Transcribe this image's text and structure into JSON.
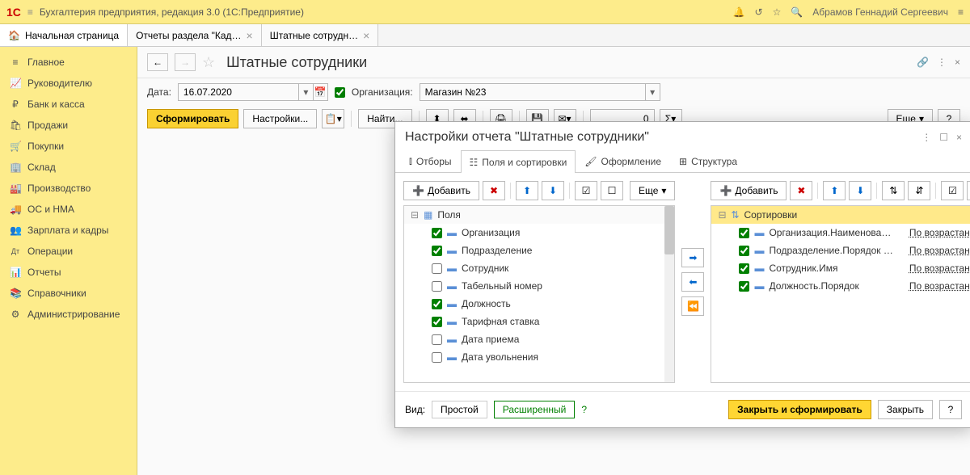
{
  "titlebar": {
    "title": "Бухгалтерия предприятия, редакция 3.0  (1С:Предприятие)",
    "user": "Абрамов Геннадий Сергеевич"
  },
  "tabs": {
    "home": "Начальная страница",
    "t1": "Отчеты раздела \"Кад…",
    "t2": "Штатные сотрудн…"
  },
  "sidebar": [
    {
      "icon": "≡",
      "label": "Главное"
    },
    {
      "icon": "📈",
      "label": "Руководителю"
    },
    {
      "icon": "₽",
      "label": "Банк и касса"
    },
    {
      "icon": "🛍",
      "label": "Продажи"
    },
    {
      "icon": "🛒",
      "label": "Покупки"
    },
    {
      "icon": "🏢",
      "label": "Склад"
    },
    {
      "icon": "🏭",
      "label": "Производство"
    },
    {
      "icon": "🚚",
      "label": "ОС и НМА"
    },
    {
      "icon": "👥",
      "label": "Зарплата и кадры"
    },
    {
      "icon": "Дт",
      "label": "Операции"
    },
    {
      "icon": "📊",
      "label": "Отчеты"
    },
    {
      "icon": "📚",
      "label": "Справочники"
    },
    {
      "icon": "⚙",
      "label": "Администрирование"
    }
  ],
  "page": {
    "title": "Штатные сотрудники",
    "date_label": "Дата:",
    "date_value": "16.07.2020",
    "org_checked": true,
    "org_label": "Организация:",
    "org_value": "Магазин №23",
    "generate": "Сформировать",
    "settings": "Настройки...",
    "find": "Найти...",
    "num": "0",
    "more": "Еще"
  },
  "modal": {
    "title": "Настройки отчета \"Штатные сотрудники\"",
    "tabs": {
      "filters": "Отборы",
      "fields": "Поля и сортировки",
      "design": "Оформление",
      "structure": "Структура"
    },
    "add": "Добавить",
    "more": "Еще",
    "fields_header": "Поля",
    "fields": [
      {
        "checked": true,
        "label": "Организация"
      },
      {
        "checked": true,
        "label": "Подразделение"
      },
      {
        "checked": false,
        "label": "Сотрудник"
      },
      {
        "checked": false,
        "label": "Табельный номер"
      },
      {
        "checked": true,
        "label": "Должность"
      },
      {
        "checked": true,
        "label": "Тарифная ставка"
      },
      {
        "checked": false,
        "label": "Дата приема"
      },
      {
        "checked": false,
        "label": "Дата увольнения"
      }
    ],
    "sort_header": "Сортировки",
    "sorts": [
      {
        "checked": true,
        "label": "Организация.Наименова…",
        "order": "По возрастанию"
      },
      {
        "checked": true,
        "label": "Подразделение.Порядок …",
        "order": "По возрастанию"
      },
      {
        "checked": true,
        "label": "Сотрудник.Имя",
        "order": "По возрастанию"
      },
      {
        "checked": true,
        "label": "Должность.Порядок",
        "order": "По возрастанию"
      }
    ],
    "view_label": "Вид:",
    "view_simple": "Простой",
    "view_ext": "Расширенный",
    "close_gen": "Закрыть и сформировать",
    "close": "Закрыть"
  }
}
